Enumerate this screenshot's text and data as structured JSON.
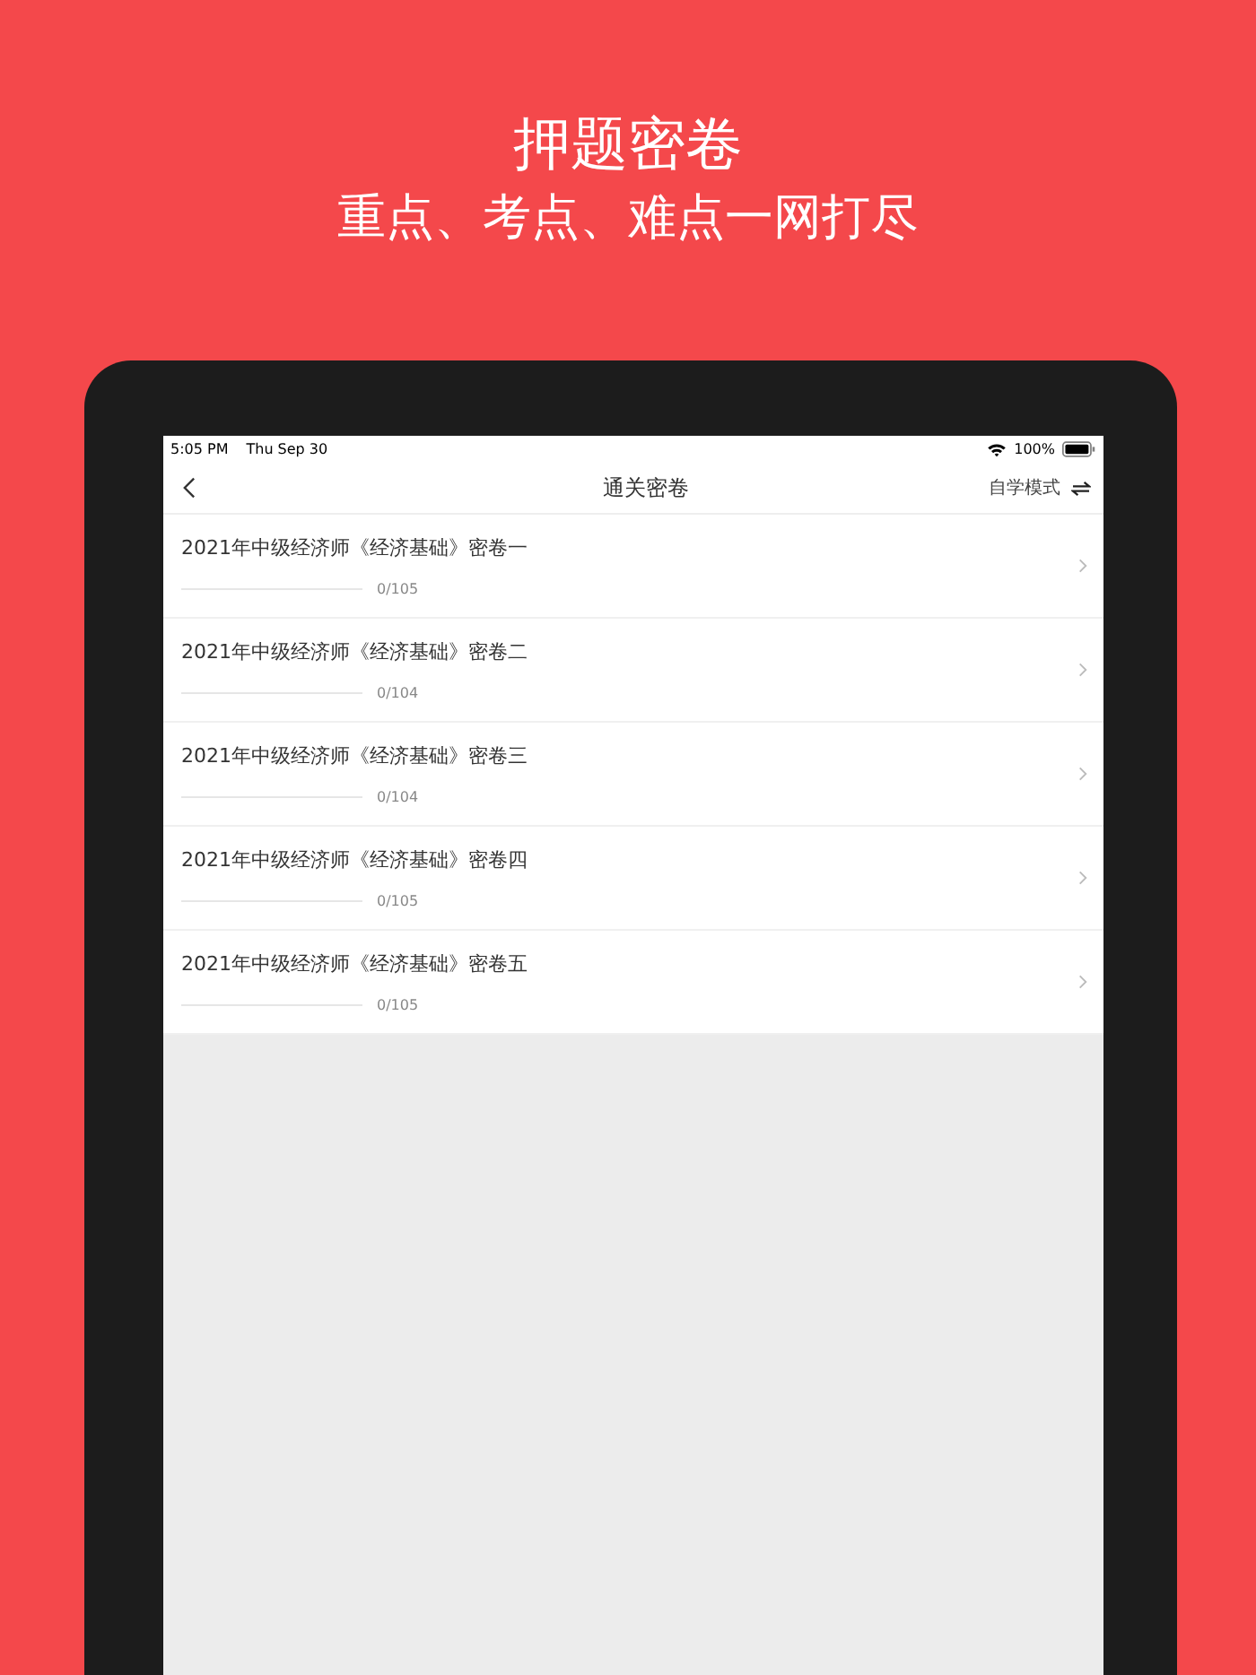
{
  "headline": "押题密卷",
  "subheadline": "重点、考点、难点一网打尽",
  "status_bar": {
    "time": "5:05 PM",
    "date": "Thu Sep 30",
    "battery": "100%"
  },
  "nav": {
    "title": "通关密卷",
    "mode": "自学模式"
  },
  "papers": [
    {
      "title": "2021年中级经济师《经济基础》密卷一",
      "level": 0,
      "count": "0/105"
    },
    {
      "title": "2021年中级经济师《经济基础》密卷二",
      "level": 0,
      "count": "0/104"
    },
    {
      "title": "2021年中级经济师《经济基础》密卷三",
      "level": 0,
      "count": "0/104"
    },
    {
      "title": "2021年中级经济师《经济基础》密卷四",
      "level": 0,
      "count": "0/105"
    },
    {
      "title": "2021年中级经济师《经济基础》密卷五",
      "level": 0,
      "count": "0/105"
    }
  ]
}
